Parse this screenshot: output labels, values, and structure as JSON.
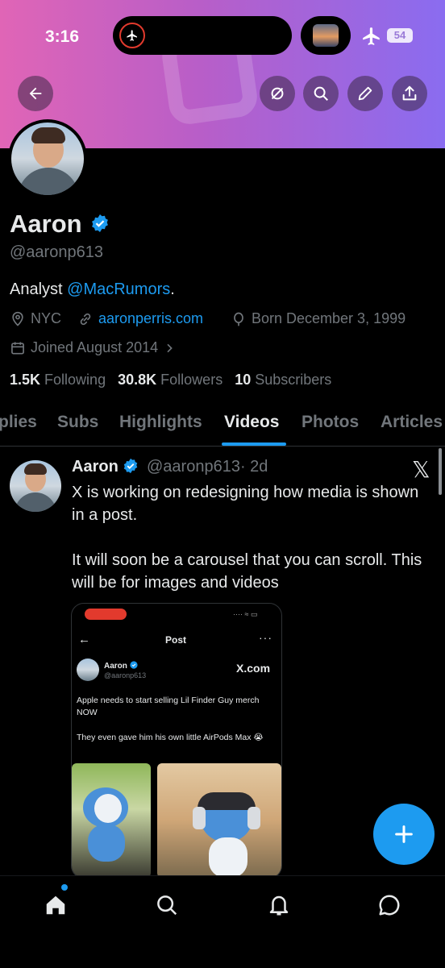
{
  "status_bar": {
    "time": "3:16",
    "battery": "54"
  },
  "profile": {
    "name": "Aaron",
    "handle": "@aaronp613",
    "bio_prefix": "Analyst ",
    "bio_link": "@MacRumors",
    "bio_suffix": ".",
    "location": "NYC",
    "website": "aaronperris.com",
    "birthday": "Born December 3, 1999",
    "joined": "Joined August 2014",
    "following_count": "1.5K",
    "following_label": "Following",
    "followers_count": "30.8K",
    "followers_label": "Followers",
    "subscribers_count": "10",
    "subscribers_label": "Subscribers"
  },
  "tabs": [
    "plies",
    "Subs",
    "Highlights",
    "Videos",
    "Photos",
    "Articles"
  ],
  "active_tab": "Videos",
  "post": {
    "author": "Aaron",
    "handle": "@aaronp613",
    "time": "· 2d",
    "text_line1": "X is working on redesigning how media is shown in a post.",
    "text_line2": "It will soon be a carousel that you can scroll. This will be for images and videos",
    "embed": {
      "title": "Post",
      "author": "Aaron",
      "handle": "@aaronp613",
      "badge_text": "X.com",
      "text_line1": "Apple needs to start selling Lil Finder Guy merch NOW",
      "text_line2": "They even gave him his own little AirPods Max 😭"
    }
  },
  "colors": {
    "accent": "#1d9bf0",
    "background": "#000000",
    "muted": "#71767b",
    "banner_start": "#e065b6",
    "banner_end": "#8a6cf0"
  },
  "icons": [
    "back-arrow-icon",
    "grok-icon",
    "search-icon",
    "edit-icon",
    "share-icon",
    "verified-icon",
    "location-icon",
    "link-icon",
    "birthday-icon",
    "calendar-icon",
    "x-logo-icon",
    "plus-icon",
    "home-icon",
    "bell-icon",
    "messages-icon"
  ]
}
